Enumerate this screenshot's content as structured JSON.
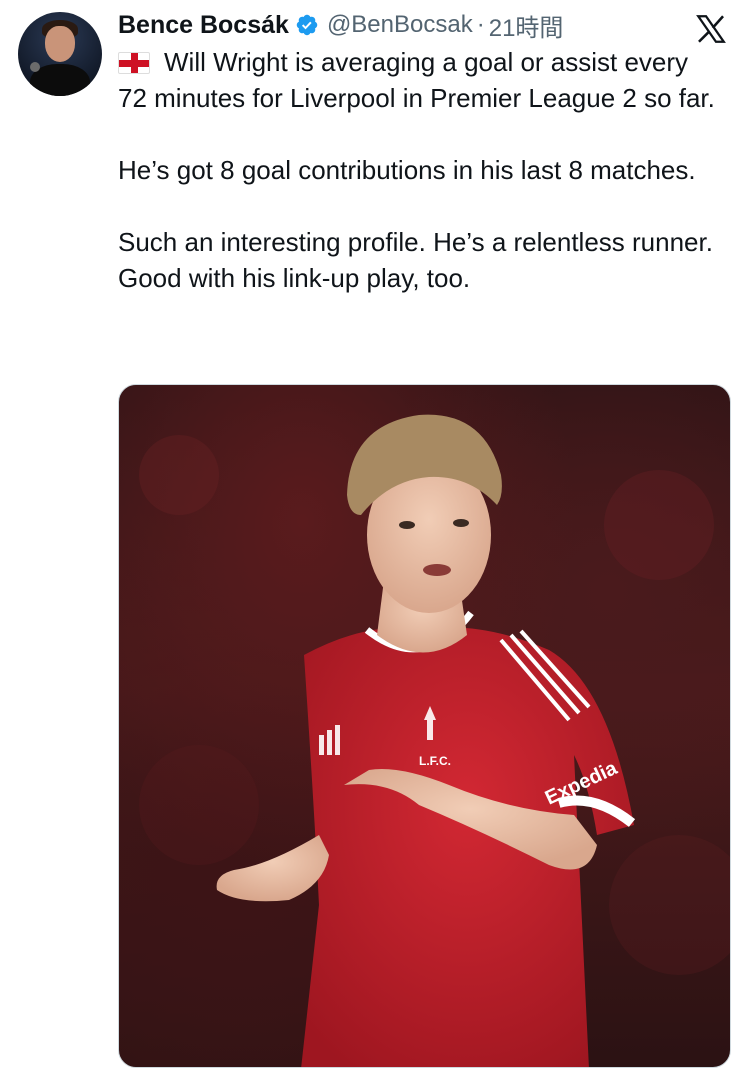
{
  "tweet": {
    "author": {
      "name": "Bence Bocsák",
      "handle": "@BenBocsak",
      "verified": true
    },
    "separator": "·",
    "timestamp": "21時間",
    "platform_icon": "x-logo-icon",
    "text": {
      "flag_icon": "england-flag-icon",
      "paragraph1": "Will Wright is averaging a goal or assist every 72 minutes for Liverpool in Premier League 2 so far.",
      "paragraph2": "He’s got 8 goal contributions in his last 8 matches.",
      "paragraph3": "Such an interesting profile. He’s a relentless runner. Good with his link-up play, too."
    },
    "media": {
      "kit_crest_text": "L.F.C.",
      "kit_sponsor_text": "Expedia"
    }
  },
  "colors": {
    "text_primary": "#0f1419",
    "text_secondary": "#536471",
    "verified_blue": "#1d9bf0",
    "kit_red": "#c8202b"
  }
}
